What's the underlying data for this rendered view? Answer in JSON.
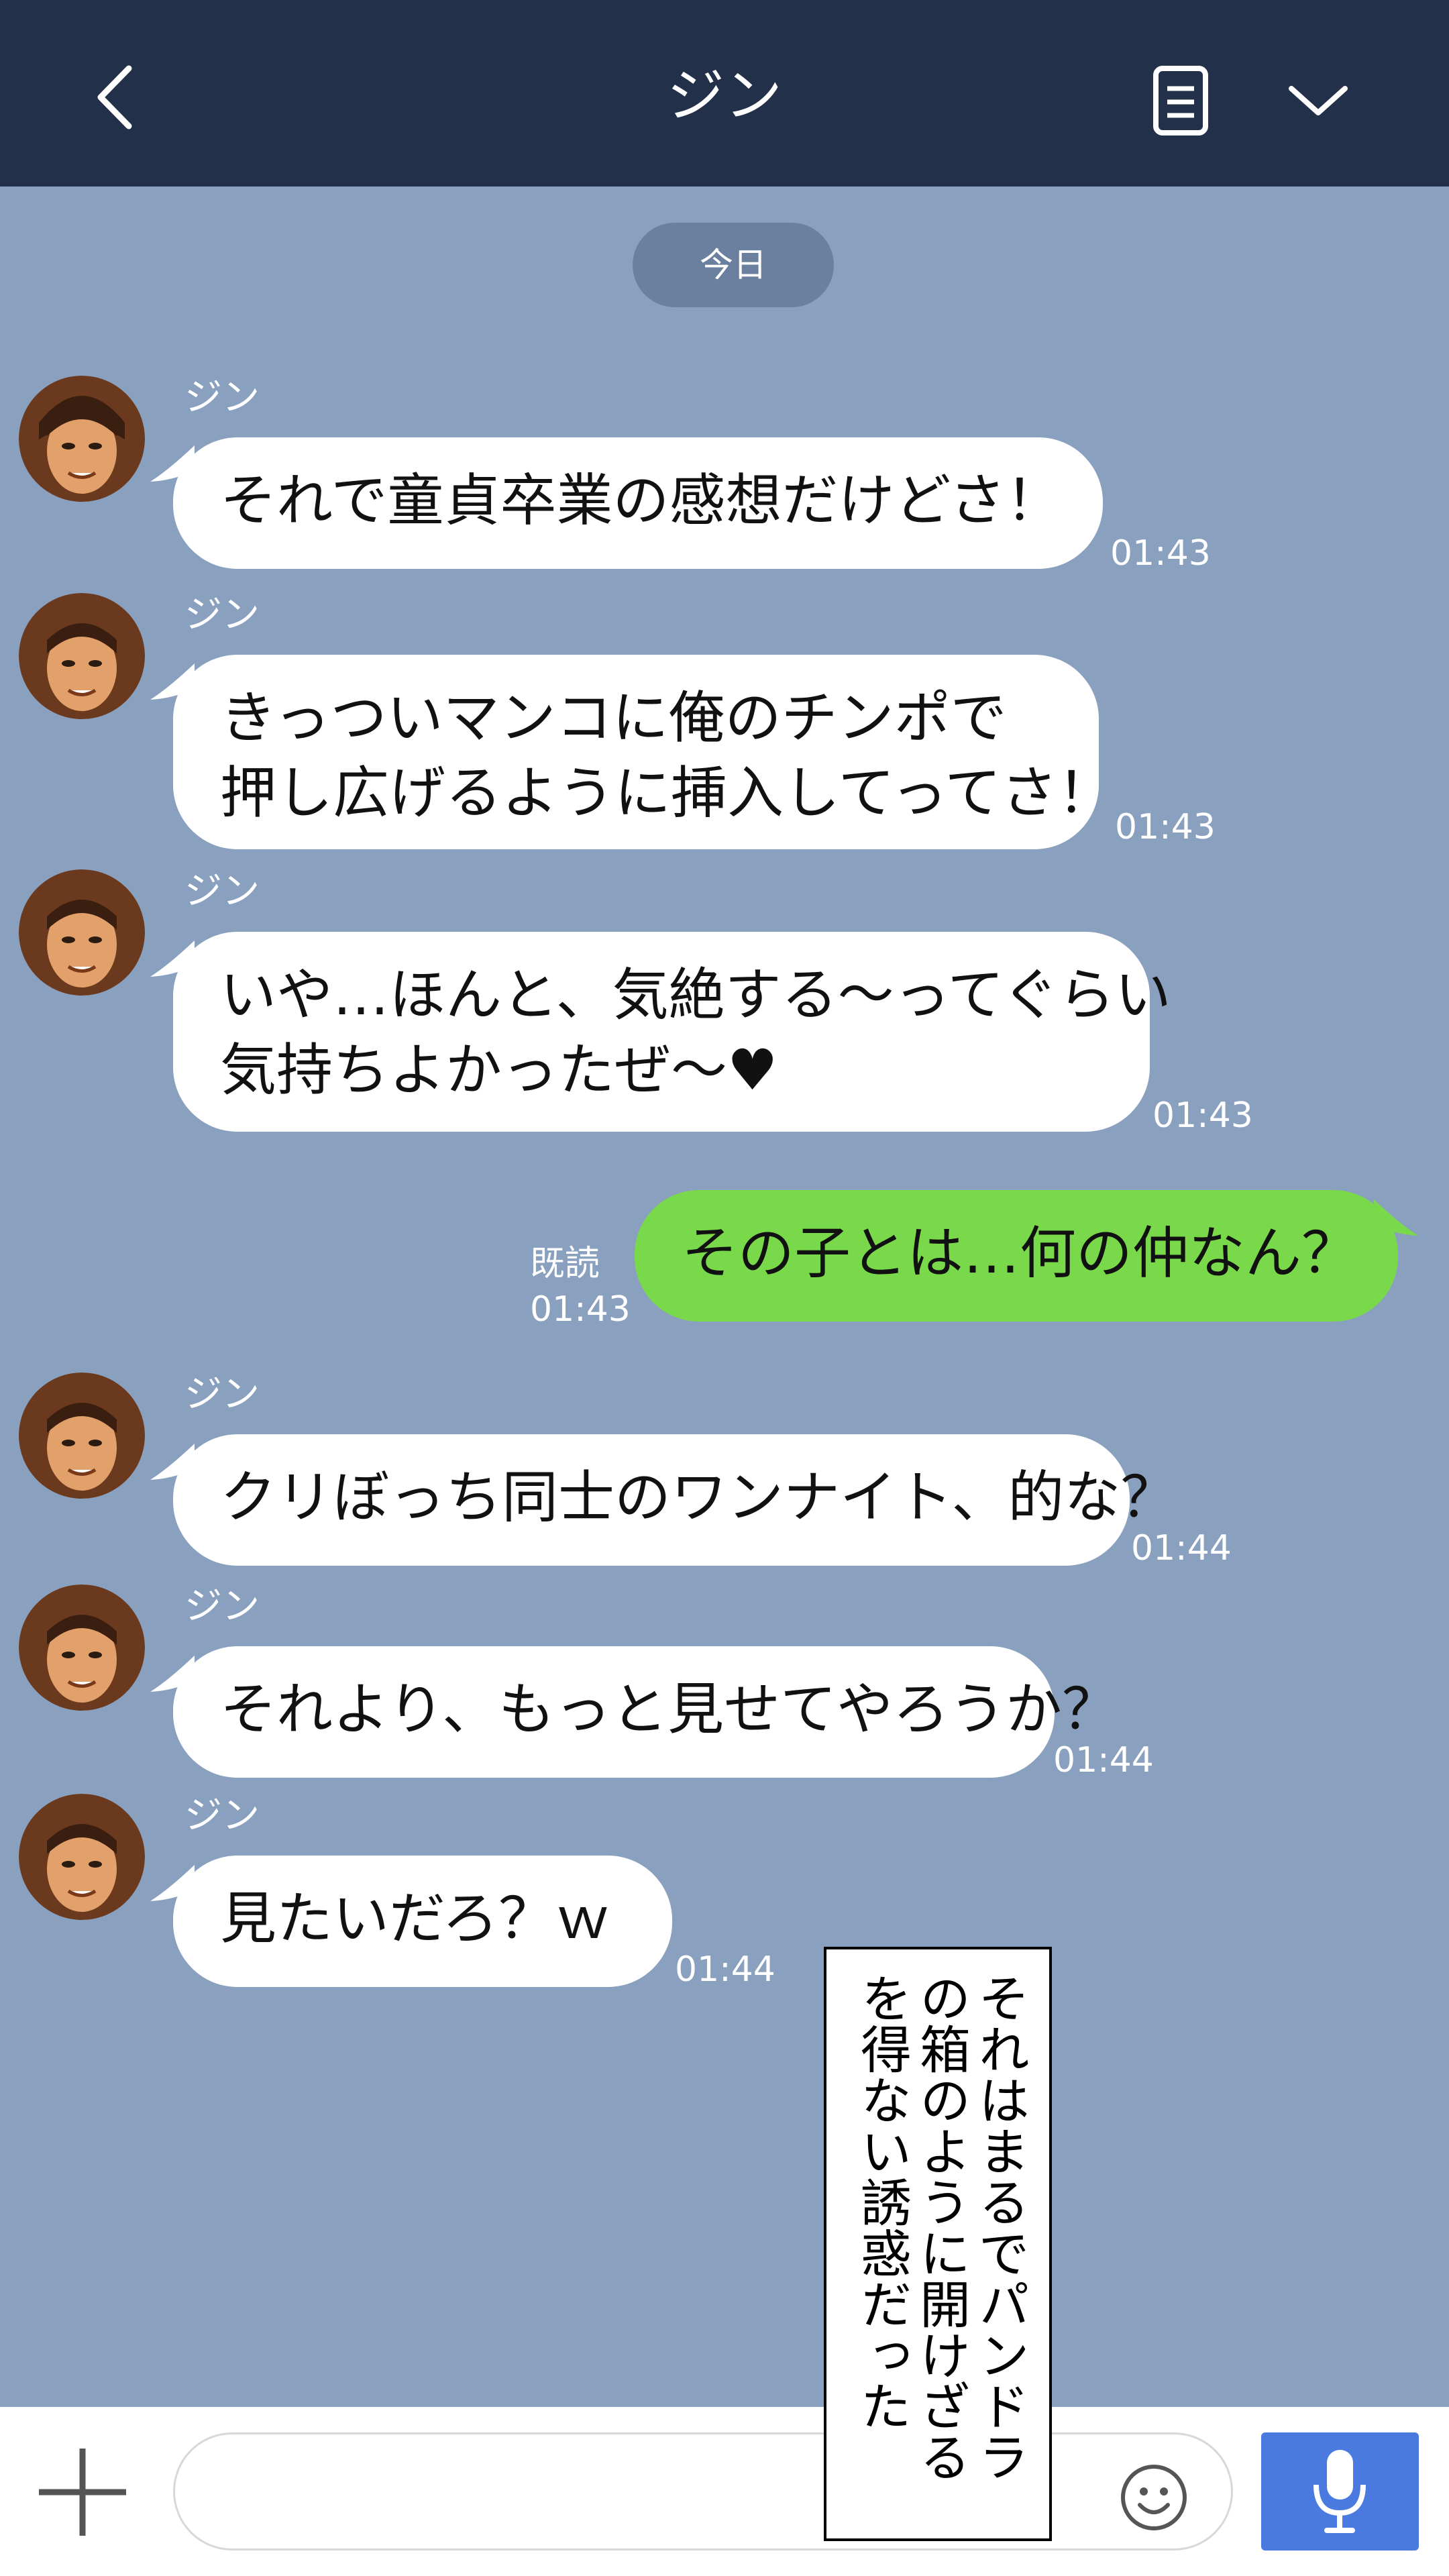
{
  "header": {
    "title": "ジン",
    "back_icon": "chevron-left-icon",
    "note_icon": "note-icon",
    "menu_icon": "chevron-down-icon"
  },
  "date_label": "今日",
  "messages": [
    {
      "sender": "ジン",
      "text": "それで童貞卒業の感想だけどさ！",
      "time": "01:43"
    },
    {
      "sender": "ジン",
      "text": "きっついマンコに俺のチンポで\n押し広げるように挿入してってさ！",
      "time": "01:43"
    },
    {
      "sender": "ジン",
      "text": "いや…ほんと、気絶する〜ってぐらい\n気持ちよかったぜ〜♥",
      "time": "01:43"
    },
    {
      "sender": "me",
      "text": "その子とは…何の仲なん？",
      "time": "01:43",
      "read": "既読"
    },
    {
      "sender": "ジン",
      "text": "クリぼっち同士のワンナイト、的な？",
      "time": "01:44"
    },
    {
      "sender": "ジン",
      "text": "それより、もっと見せてやろうか？",
      "time": "01:44"
    },
    {
      "sender": "ジン",
      "text": "見たいだろ？ｗ",
      "time": "01:44"
    }
  ],
  "caption": "それはまるでパンドラの箱のように開けざるを得ない誘惑だった",
  "input": {
    "placeholder": "",
    "plus_icon": "plus-icon",
    "emoji_icon": "smile-icon",
    "mic_icon": "microphone-icon"
  },
  "colors": {
    "header_bg": "#223049",
    "chat_bg": "#8aa0bf",
    "my_bubble": "#7ad94a",
    "their_bubble": "#ffffff",
    "mic_button": "#4a7ae0"
  }
}
